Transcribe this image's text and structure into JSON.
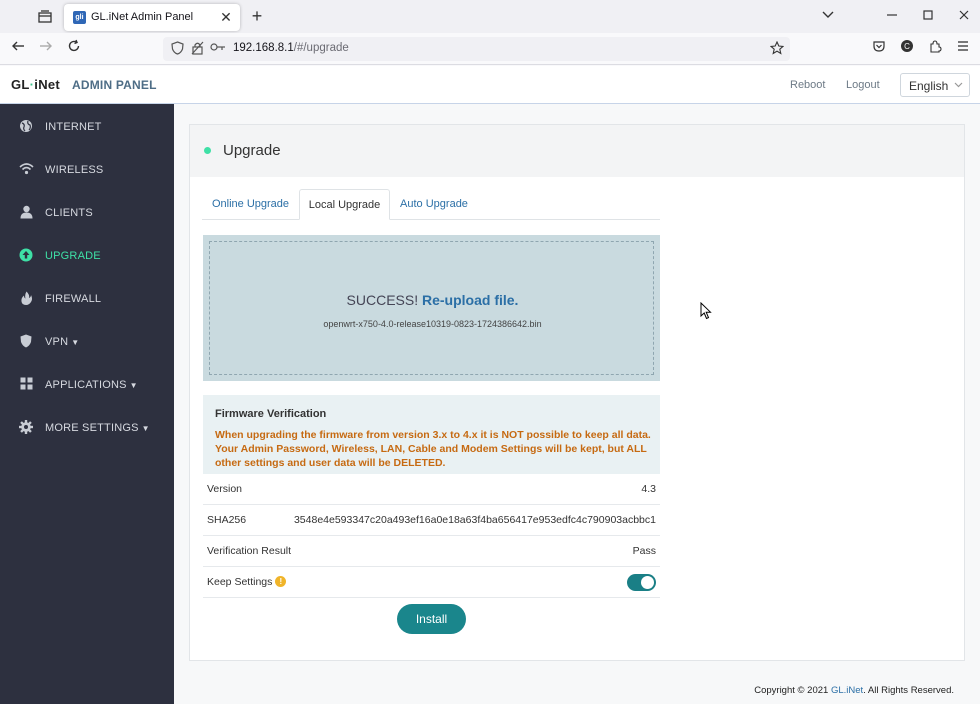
{
  "browser": {
    "tab_title": "GL.iNet Admin Panel",
    "favicon_text": "gli",
    "url_host": "192.168.8.1",
    "url_path": "/#/upgrade",
    "tab_close": "✕",
    "new_tab": "+",
    "icons": [
      "tab-list-icon",
      "back-icon",
      "forward-icon",
      "reload-icon",
      "shield-icon",
      "permissions-icon",
      "key-icon",
      "bookmark-star-icon",
      "pocket-icon",
      "account-icon",
      "extensions-icon",
      "menu-icon",
      "minimize-icon",
      "maximize-icon",
      "close-icon",
      "chevron-down-icon"
    ]
  },
  "header": {
    "logo": "GL·iNet",
    "logo_left": "GL",
    "logo_dot": "·",
    "logo_right": "iNet",
    "admin_label": "ADMIN PANEL",
    "reboot": "Reboot",
    "logout": "Logout",
    "language": "English"
  },
  "sidebar": {
    "items": [
      {
        "label": "INTERNET",
        "icon": "globe-icon"
      },
      {
        "label": "WIRELESS",
        "icon": "wifi-icon"
      },
      {
        "label": "CLIENTS",
        "icon": "user-icon"
      },
      {
        "label": "UPGRADE",
        "icon": "upload-circle-icon"
      },
      {
        "label": "FIREWALL",
        "icon": "fire-icon"
      },
      {
        "label": "VPN",
        "icon": "shield-icon"
      },
      {
        "label": "APPLICATIONS",
        "icon": "grid-icon"
      },
      {
        "label": "MORE SETTINGS",
        "icon": "gear-icon"
      }
    ],
    "active_color": "#3ee0a6"
  },
  "page": {
    "title": "Upgrade",
    "tabs": [
      "Online Upgrade",
      "Local Upgrade",
      "Auto Upgrade"
    ],
    "active_tab": "Local Upgrade",
    "upload": {
      "status": "SUCCESS!",
      "reupload": "Re-upload file.",
      "filename": "openwrt-x750-4.0-release10319-0823-1724386642.bin"
    },
    "verification": {
      "title": "Firmware Verification",
      "warning_1": "When upgrading the firmware from version 3.x to 4.x it is NOT possible to keep all data.",
      "warning_2": "Your Admin Password, Wireless, LAN, Cable and Modem Settings will be kept, but ALL other settings and user data will be DELETED."
    },
    "rows": {
      "version_label": "Version",
      "version_value": "4.3",
      "sha_label": "SHA256",
      "sha_value": "3548e4e593347c20a493ef16a0e18a63f4ba656417e953edfc4c790903acbbc1",
      "result_label": "Verification Result",
      "result_value": "Pass",
      "keep_label": "Keep Settings",
      "keep_info": "!",
      "keep_enabled": true
    },
    "install": "Install"
  },
  "footer": {
    "prefix": "Copyright © 2021 ",
    "brand": "GL.iNet",
    "suffix": ". All Rights Reserved."
  },
  "colors": {
    "accent": "#3ee0a6",
    "link": "#2b6fa6",
    "warning": "#c66a12",
    "primary_button": "#1a868c",
    "sidebar_bg": "#2d303f"
  }
}
